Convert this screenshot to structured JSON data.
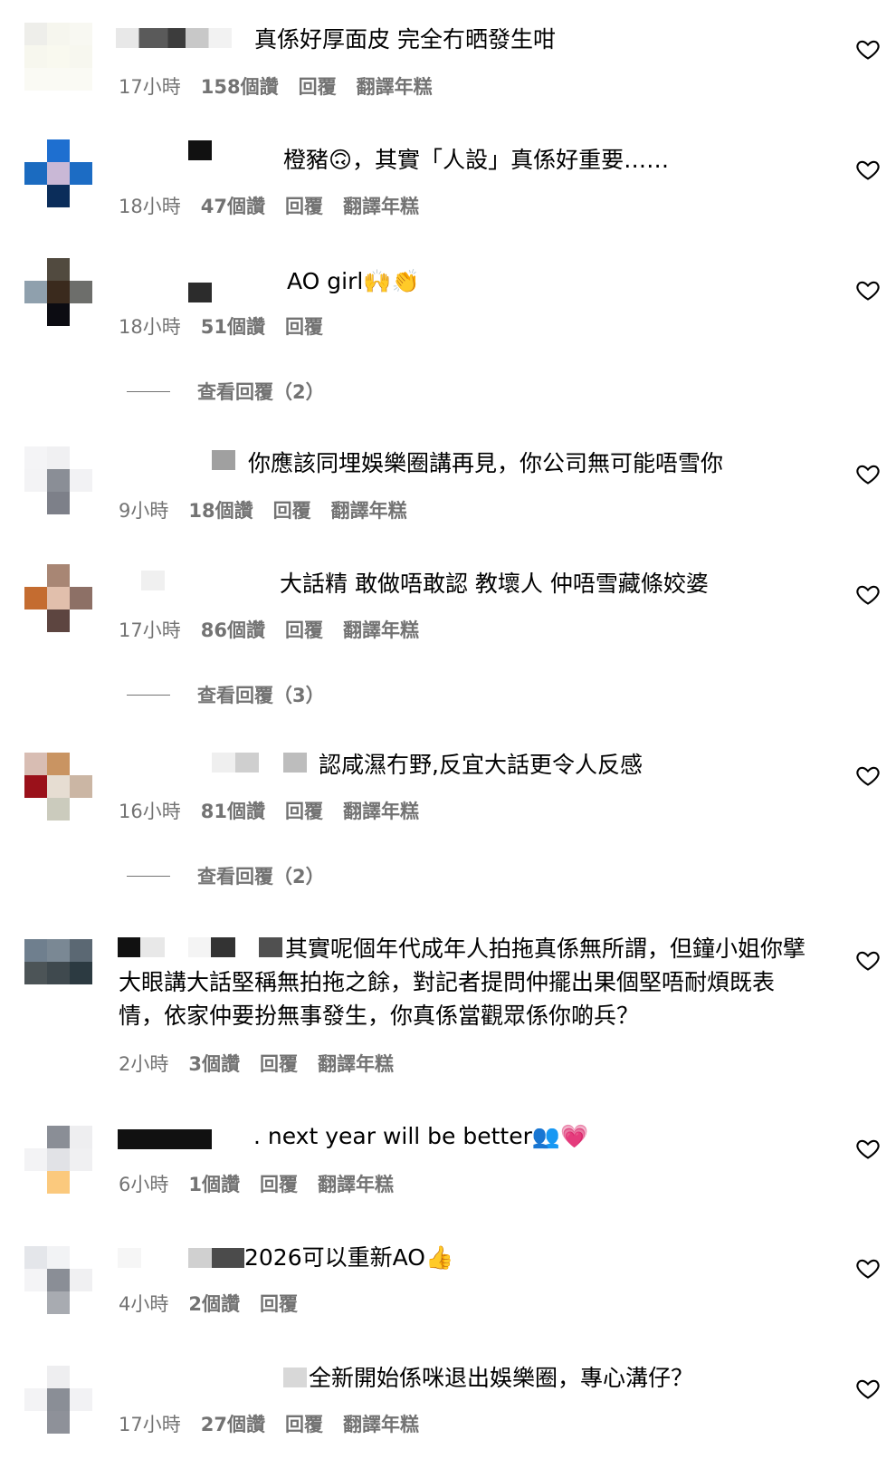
{
  "comments": [
    {
      "text": "真係好厚面皮 完全冇晒發生咁",
      "time": "17小時",
      "likes": "158個讚",
      "reply": "回覆",
      "translate": "翻譯年糕"
    },
    {
      "text": "橙豬🙃，其實「人設」真係好重要……",
      "time": "18小時",
      "likes": "47個讚",
      "reply": "回覆",
      "translate": "翻譯年糕"
    },
    {
      "text": "AO girl🙌👏",
      "time": "18小時",
      "likes": "51個讚",
      "reply": "回覆",
      "translate": ""
    },
    {
      "text": "你應該同埋娛樂圈講再見，你公司無可能唔雪你",
      "time": "9小時",
      "likes": "18個讚",
      "reply": "回覆",
      "translate": "翻譯年糕"
    },
    {
      "text": "大話精 敢做唔敢認 教壞人 仲唔雪藏條姣婆",
      "time": "17小時",
      "likes": "86個讚",
      "reply": "回覆",
      "translate": "翻譯年糕"
    },
    {
      "text": "認咸濕冇野,反宜大話更令人反感",
      "time": "16小時",
      "likes": "81個讚",
      "reply": "回覆",
      "translate": "翻譯年糕"
    },
    {
      "text": "其實呢個年代成年人拍拖真係無所謂，但鐘小姐你擘大眼講大話堅稱無拍拖之餘，對記者提問仲擺出果個堅唔耐煩既表情，依家仲要扮無事發生，你真係當觀眾係你啲兵？",
      "time": "2小時",
      "likes": "3個讚",
      "reply": "回覆",
      "translate": "翻譯年糕"
    },
    {
      "text": ". next year will be better👥💗",
      "time": "6小時",
      "likes": "1個讚",
      "reply": "回覆",
      "translate": "翻譯年糕"
    },
    {
      "text": "2026可以重新AO👍",
      "time": "4小時",
      "likes": "2個讚",
      "reply": "回覆",
      "translate": ""
    },
    {
      "text": "全新開始係咪退出娛樂圈，專心溝仔？",
      "time": "17小時",
      "likes": "27個讚",
      "reply": "回覆",
      "translate": "翻譯年糕"
    }
  ],
  "view_replies": [
    {
      "label": "查看回覆（2）"
    },
    {
      "label": "查看回覆（3）"
    },
    {
      "label": "查看回覆（2）"
    }
  ],
  "colors": {
    "meta": "#737373",
    "text": "#000000",
    "bg": "#ffffff"
  },
  "icons": {
    "like": "heart-outline-icon"
  }
}
